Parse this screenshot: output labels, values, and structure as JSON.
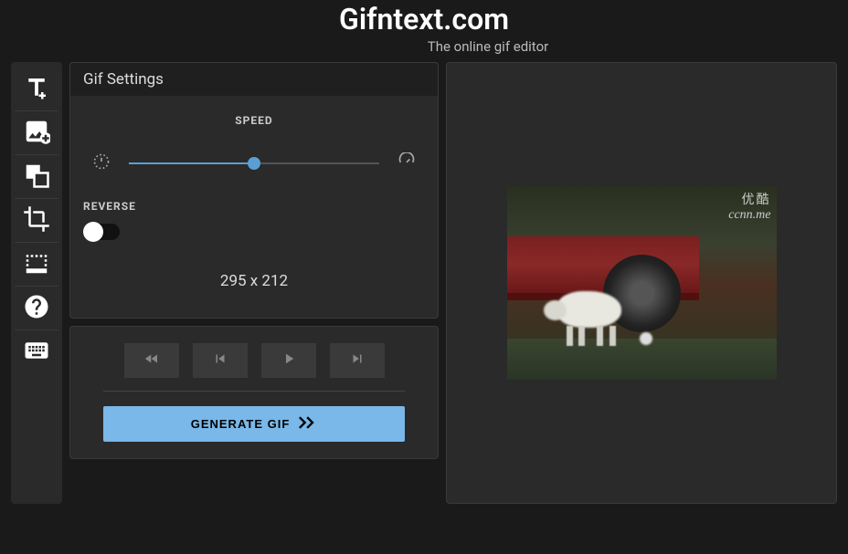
{
  "header": {
    "logo": "Gifntext.com",
    "tagline": "The online gif editor"
  },
  "settings": {
    "title": "Gif Settings",
    "speed_label": "SPEED",
    "reverse_label": "REVERSE",
    "dimensions": "295 x 212"
  },
  "controls": {
    "generate_label": "GENERATE GIF"
  },
  "preview": {
    "watermark_chinese": "优酷",
    "watermark_url": "ccnn.me"
  }
}
